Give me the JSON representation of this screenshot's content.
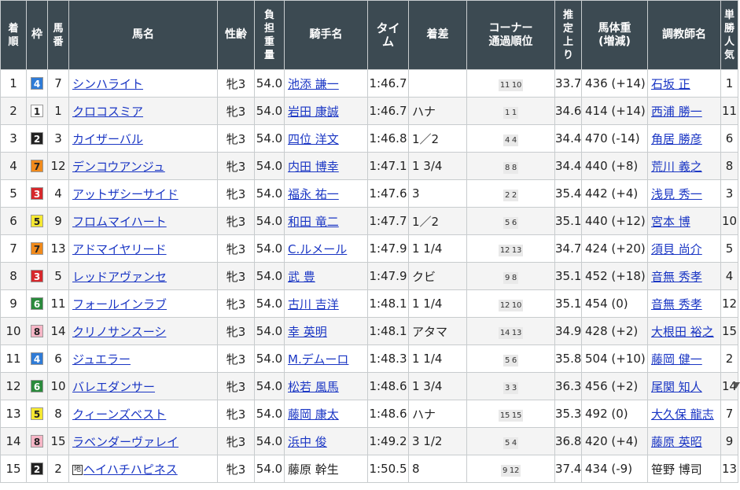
{
  "headers": {
    "rank": "着順",
    "waku": "枠",
    "umaban": "馬番",
    "name": "馬名",
    "sexage": "性齢",
    "weight": "負担重量",
    "jockey": "騎手名",
    "time": "タイム",
    "margin": "着差",
    "corner": "コーナー通過順位",
    "last3f": "推定上り",
    "body_weight": "馬体重(増減)",
    "trainer": "調教師名",
    "popularity": "単勝人気"
  },
  "waku_colors": {
    "1": {
      "bg": "#ffffff",
      "fg": "#222222"
    },
    "2": {
      "bg": "#222222",
      "fg": "#ffffff"
    },
    "3": {
      "bg": "#d6282c",
      "fg": "#ffffff"
    },
    "4": {
      "bg": "#2f7bd6",
      "fg": "#ffffff"
    },
    "5": {
      "bg": "#f5e832",
      "fg": "#222222"
    },
    "6": {
      "bg": "#2a8a3c",
      "fg": "#ffffff"
    },
    "7": {
      "bg": "#f08a1c",
      "fg": "#222222"
    },
    "8": {
      "bg": "#f6b6c6",
      "fg": "#222222"
    }
  },
  "chihou_mark": "地",
  "rows": [
    {
      "rank": "1",
      "waku": "4",
      "umaban": "7",
      "name": "シンハライト",
      "chihou": false,
      "sexage": "牝3",
      "weight": "54.0",
      "jockey": "池添 謙一",
      "jockey_link": true,
      "time": "1:46.7",
      "margin": "",
      "corner": "11 10",
      "last3f": "33.7",
      "body_weight": "436 (+14)",
      "trainer": "石坂 正",
      "trainer_link": true,
      "popularity": "1"
    },
    {
      "rank": "2",
      "waku": "1",
      "umaban": "1",
      "name": "クロコスミア",
      "chihou": false,
      "sexage": "牝3",
      "weight": "54.0",
      "jockey": "岩田 康誠",
      "jockey_link": true,
      "time": "1:46.7",
      "margin": "ハナ",
      "corner": "1 1",
      "last3f": "34.6",
      "body_weight": "414 (+14)",
      "trainer": "西浦 勝一",
      "trainer_link": true,
      "popularity": "11"
    },
    {
      "rank": "3",
      "waku": "2",
      "umaban": "3",
      "name": "カイザーバル",
      "chihou": false,
      "sexage": "牝3",
      "weight": "54.0",
      "jockey": "四位 洋文",
      "jockey_link": true,
      "time": "1:46.8",
      "margin": "1／2",
      "corner": "4 4",
      "last3f": "34.4",
      "body_weight": "470 (-14)",
      "trainer": "角居 勝彦",
      "trainer_link": true,
      "popularity": "6"
    },
    {
      "rank": "4",
      "waku": "7",
      "umaban": "12",
      "name": "デンコウアンジュ",
      "chihou": false,
      "sexage": "牝3",
      "weight": "54.0",
      "jockey": "内田 博幸",
      "jockey_link": true,
      "time": "1:47.1",
      "margin": "1 3/4",
      "corner": "8 8",
      "last3f": "34.4",
      "body_weight": "440 (+8)",
      "trainer": "荒川 義之",
      "trainer_link": true,
      "popularity": "8"
    },
    {
      "rank": "5",
      "waku": "3",
      "umaban": "4",
      "name": "アットザシーサイド",
      "chihou": false,
      "sexage": "牝3",
      "weight": "54.0",
      "jockey": "福永 祐一",
      "jockey_link": true,
      "time": "1:47.6",
      "margin": "3",
      "corner": "2 2",
      "last3f": "35.4",
      "body_weight": "442 (+4)",
      "trainer": "浅見 秀一",
      "trainer_link": true,
      "popularity": "3"
    },
    {
      "rank": "6",
      "waku": "5",
      "umaban": "9",
      "name": "フロムマイハート",
      "chihou": false,
      "sexage": "牝3",
      "weight": "54.0",
      "jockey": "和田 竜二",
      "jockey_link": true,
      "time": "1:47.7",
      "margin": "1／2",
      "corner": "5 6",
      "last3f": "35.1",
      "body_weight": "440 (+12)",
      "trainer": "宮本 博",
      "trainer_link": true,
      "popularity": "10"
    },
    {
      "rank": "7",
      "waku": "7",
      "umaban": "13",
      "name": "アドマイヤリード",
      "chihou": false,
      "sexage": "牝3",
      "weight": "54.0",
      "jockey": "C.ルメール",
      "jockey_link": true,
      "time": "1:47.9",
      "margin": "1 1/4",
      "corner": "12 13",
      "last3f": "34.7",
      "body_weight": "424 (+20)",
      "trainer": "須貝 尚介",
      "trainer_link": true,
      "popularity": "5"
    },
    {
      "rank": "8",
      "waku": "3",
      "umaban": "5",
      "name": "レッドアヴァンセ",
      "chihou": false,
      "sexage": "牝3",
      "weight": "54.0",
      "jockey": "武 豊",
      "jockey_link": true,
      "time": "1:47.9",
      "margin": "クビ",
      "corner": "9 8",
      "last3f": "35.1",
      "body_weight": "452 (+18)",
      "trainer": "音無 秀孝",
      "trainer_link": true,
      "popularity": "4"
    },
    {
      "rank": "9",
      "waku": "6",
      "umaban": "11",
      "name": "フォールインラブ",
      "chihou": false,
      "sexage": "牝3",
      "weight": "54.0",
      "jockey": "古川 吉洋",
      "jockey_link": true,
      "time": "1:48.1",
      "margin": "1 1/4",
      "corner": "12 10",
      "last3f": "35.1",
      "body_weight": "454 (0)",
      "trainer": "音無 秀孝",
      "trainer_link": true,
      "popularity": "12"
    },
    {
      "rank": "10",
      "waku": "8",
      "umaban": "14",
      "name": "クリノサンスーシ",
      "chihou": false,
      "sexage": "牝3",
      "weight": "54.0",
      "jockey": "幸 英明",
      "jockey_link": true,
      "time": "1:48.1",
      "margin": "アタマ",
      "corner": "14 13",
      "last3f": "34.9",
      "body_weight": "428 (+2)",
      "trainer": "大根田 裕之",
      "trainer_link": true,
      "popularity": "15"
    },
    {
      "rank": "11",
      "waku": "4",
      "umaban": "6",
      "name": "ジュエラー",
      "chihou": false,
      "sexage": "牝3",
      "weight": "54.0",
      "jockey": "M.デムーロ",
      "jockey_link": true,
      "time": "1:48.3",
      "margin": "1 1/4",
      "corner": "5 6",
      "last3f": "35.8",
      "body_weight": "504 (+10)",
      "trainer": "藤岡 健一",
      "trainer_link": true,
      "popularity": "2"
    },
    {
      "rank": "12",
      "waku": "6",
      "umaban": "10",
      "name": "バレエダンサー",
      "chihou": false,
      "sexage": "牝3",
      "weight": "54.0",
      "jockey": "松若 風馬",
      "jockey_link": true,
      "time": "1:48.6",
      "margin": "1 3/4",
      "corner": "3 3",
      "last3f": "36.3",
      "body_weight": "456 (+2)",
      "trainer": "尾関 知人",
      "trainer_link": true,
      "popularity": "14"
    },
    {
      "rank": "13",
      "waku": "5",
      "umaban": "8",
      "name": "クィーンズベスト",
      "chihou": false,
      "sexage": "牝3",
      "weight": "54.0",
      "jockey": "藤岡 康太",
      "jockey_link": true,
      "time": "1:48.6",
      "margin": "ハナ",
      "corner": "15 15",
      "last3f": "35.3",
      "body_weight": "492 (0)",
      "trainer": "大久保 龍志",
      "trainer_link": true,
      "popularity": "7"
    },
    {
      "rank": "14",
      "waku": "8",
      "umaban": "15",
      "name": "ラベンダーヴァレイ",
      "chihou": false,
      "sexage": "牝3",
      "weight": "54.0",
      "jockey": "浜中 俊",
      "jockey_link": true,
      "time": "1:49.2",
      "margin": "3 1/2",
      "corner": "5 4",
      "last3f": "36.8",
      "body_weight": "420 (+4)",
      "trainer": "藤原 英昭",
      "trainer_link": true,
      "popularity": "9"
    },
    {
      "rank": "15",
      "waku": "2",
      "umaban": "2",
      "name": "ヘイハチハピネス",
      "chihou": true,
      "sexage": "牝3",
      "weight": "54.0",
      "jockey": "藤原 幹生",
      "jockey_link": false,
      "time": "1:50.5",
      "margin": "8",
      "corner": "9 12",
      "last3f": "37.4",
      "body_weight": "434 (-9)",
      "trainer": "笹野 博司",
      "trainer_link": false,
      "popularity": "13"
    }
  ]
}
